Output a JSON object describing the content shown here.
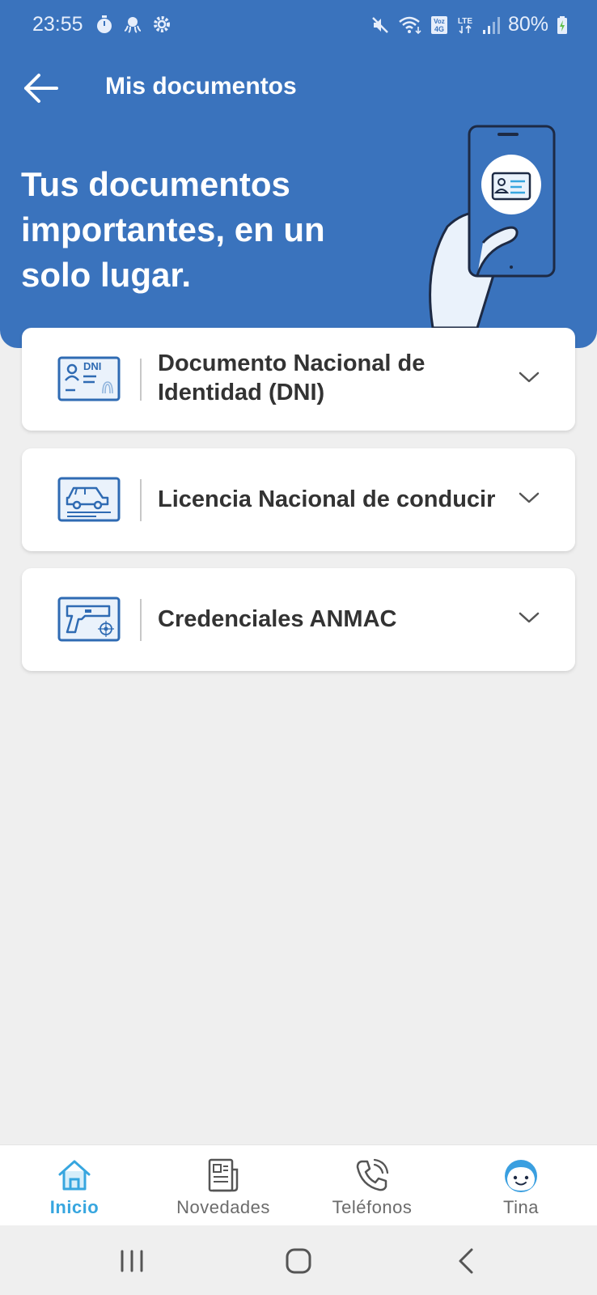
{
  "status_bar": {
    "time": "23:55",
    "battery": "80%",
    "left_icons": [
      "timer-icon",
      "octopus-icon",
      "gear-icon"
    ],
    "right_icons": [
      "mute-icon",
      "wifi-icon",
      "volte-icon",
      "lte-icon",
      "signal-icon",
      "battery-icon"
    ]
  },
  "app_bar": {
    "title": "Mis documentos"
  },
  "hero": {
    "heading": "Tus documentos importantes, en un solo lugar."
  },
  "documents": [
    {
      "label_line1": "Documento Nacional de",
      "label_line2": "Identidad (DNI)",
      "icon": "dni-card-icon",
      "icon_text": "DNI"
    },
    {
      "label": "Licencia Nacional de conducir",
      "icon": "driver-license-icon"
    },
    {
      "label": "Credenciales ANMAC",
      "icon": "gun-credential-icon"
    }
  ],
  "bottom_nav": {
    "items": [
      {
        "label": "Inicio",
        "icon": "home-icon",
        "active": true
      },
      {
        "label": "Novedades",
        "icon": "news-icon",
        "active": false
      },
      {
        "label": "Teléfonos",
        "icon": "phone-icon",
        "active": false
      },
      {
        "label": "Tina",
        "icon": "tina-face-icon",
        "active": false
      }
    ]
  },
  "colors": {
    "primary": "#3a73bd",
    "accent": "#37a6df",
    "background": "#efefef",
    "card": "#ffffff",
    "text": "#333333"
  }
}
